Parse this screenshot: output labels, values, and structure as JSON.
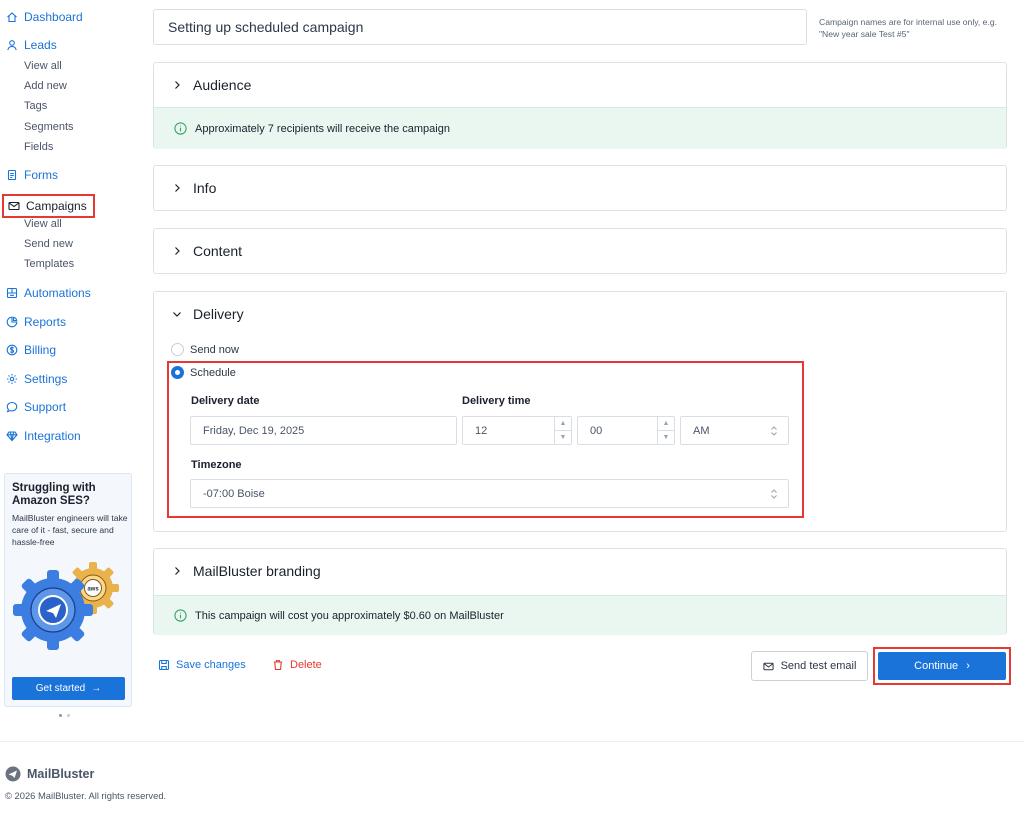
{
  "sidebar": {
    "dashboard": "Dashboard",
    "leads": "Leads",
    "leads_sub": [
      "View all",
      "Add new",
      "Tags",
      "Segments",
      "Fields"
    ],
    "forms": "Forms",
    "campaigns": "Campaigns",
    "campaigns_sub": [
      "View all",
      "Send new",
      "Templates"
    ],
    "automations": "Automations",
    "reports": "Reports",
    "billing": "Billing",
    "settings": "Settings",
    "support": "Support",
    "integration": "Integration"
  },
  "promo": {
    "title": "Struggling with Amazon SES?",
    "text": "MailBluster engineers will take care of it - fast, secure and hassle-free",
    "aws_label": "aws",
    "button": "Get started",
    "button_arrow": "→"
  },
  "campaign": {
    "name": "Setting up scheduled campaign",
    "name_hint": "Campaign names are for internal use only, e.g. \"New year sale Test #5\""
  },
  "sections": {
    "audience": "Audience",
    "audience_info": "Approximately 7 recipients will receive the campaign",
    "info": "Info",
    "content": "Content",
    "delivery": "Delivery",
    "branding": "MailBluster branding",
    "branding_info": "This campaign will cost you approximately $0.60 on MailBluster"
  },
  "delivery": {
    "send_now": "Send now",
    "schedule": "Schedule",
    "date_label": "Delivery date",
    "date_value": "Friday, Dec 19, 2025",
    "time_label": "Delivery time",
    "hour": "12",
    "minute": "00",
    "ampm": "AM",
    "timezone_label": "Timezone",
    "timezone_value": "-07:00 Boise"
  },
  "actions": {
    "save": "Save changes",
    "delete": "Delete",
    "test": "Send test email",
    "continue": "Continue",
    "continue_arrow": "›"
  },
  "footer": {
    "logo": "MailBluster",
    "copyright": "© 2026 MailBluster. All rights reserved."
  },
  "colors": {
    "primary": "#1a73d9",
    "highlight": "#e53935",
    "success_bg": "#eaf7f0",
    "danger": "#e53935"
  }
}
